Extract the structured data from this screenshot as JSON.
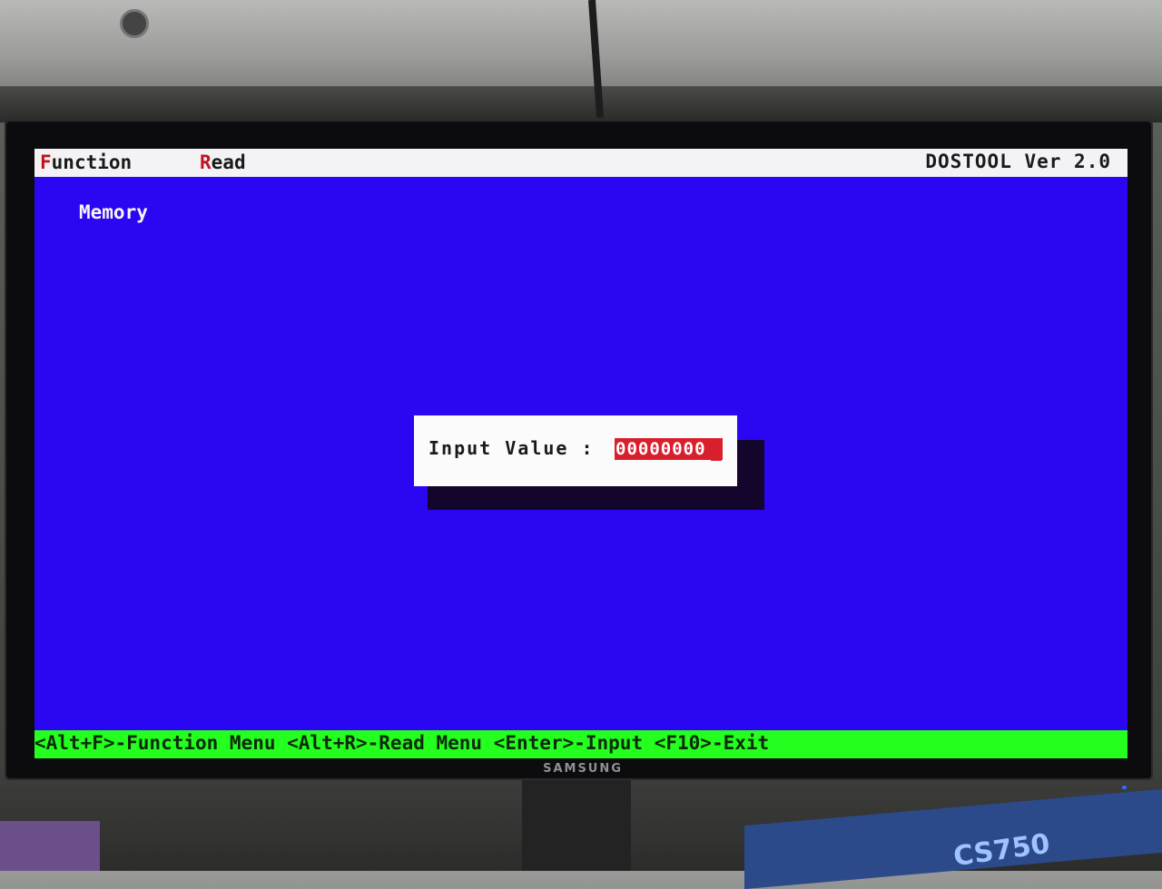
{
  "menubar": {
    "function": {
      "hotkey": "F",
      "rest": "unction"
    },
    "read": {
      "hotkey": "R",
      "rest": "ead"
    },
    "title": "DOSTOOL Ver 2.0"
  },
  "content": {
    "label": "Memory"
  },
  "dialog": {
    "label": "Input Value :",
    "value": "00000000"
  },
  "statusbar": {
    "text": "<Alt+F>-Function Menu <Alt+R>-Read Menu <Enter>-Input <F10>-Exit"
  },
  "monitor": {
    "brand": "SAMSUNG"
  },
  "background": {
    "box_label": "CS750"
  },
  "colors": {
    "screen_bg": "#2a06f2",
    "menubar_bg": "#f3f3f5",
    "statusbar_bg": "#24ff1f",
    "input_bg": "#d91f2e",
    "hotkey": "#c1121f"
  }
}
